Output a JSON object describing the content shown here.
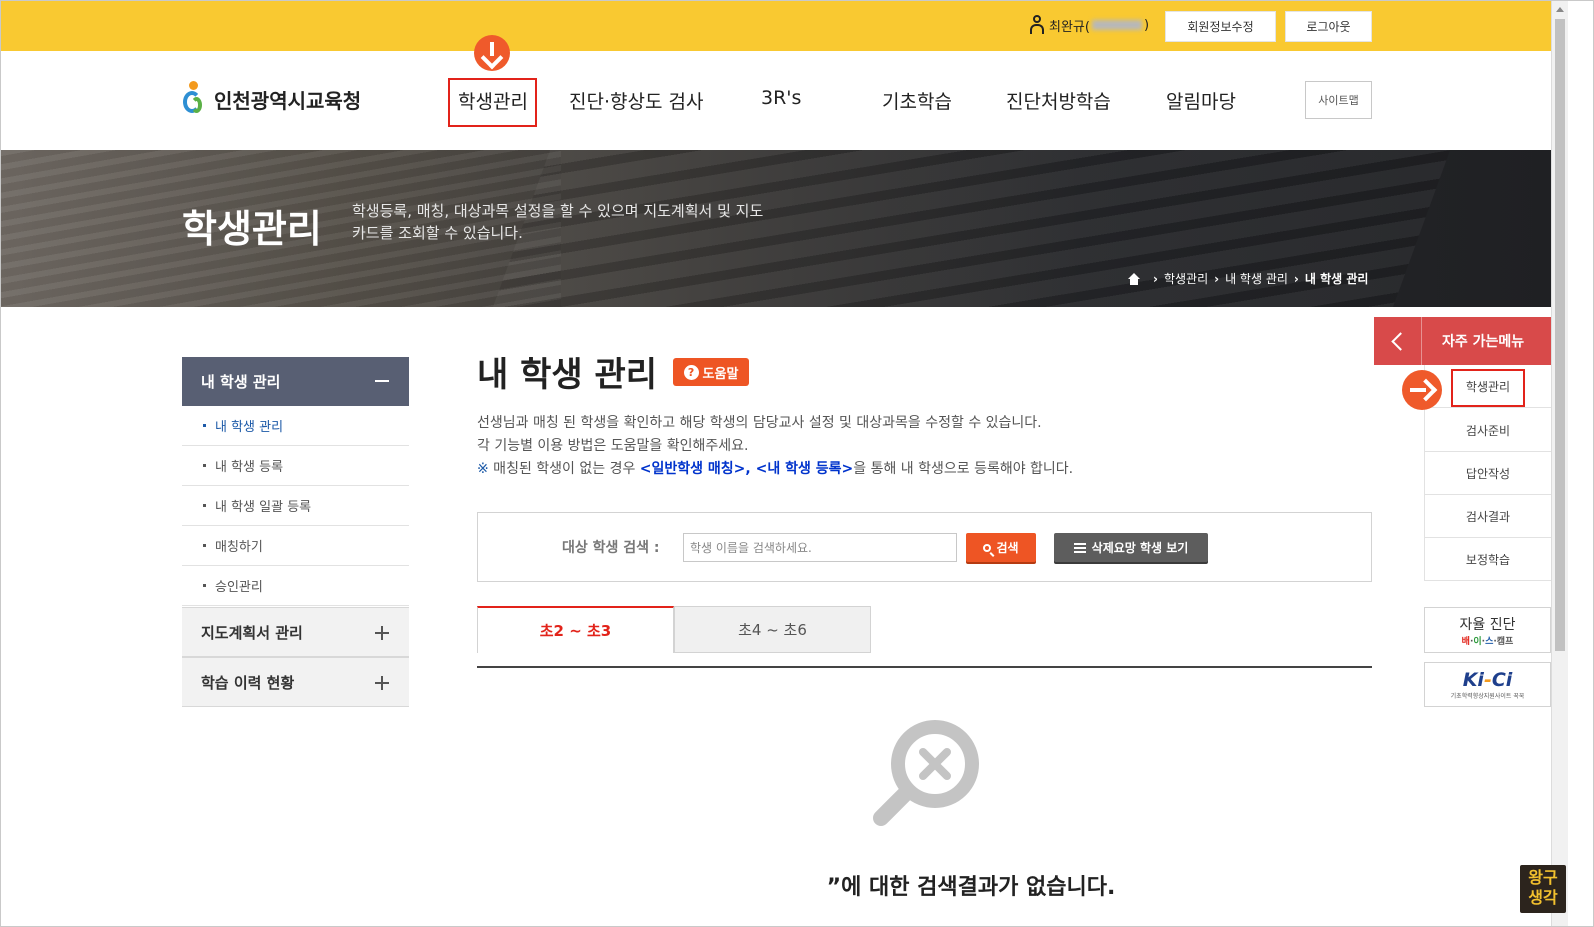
{
  "topbar": {
    "user_name": "최완규(",
    "user_suffix": ")",
    "edit_profile": "회원정보수정",
    "logout": "로그아웃"
  },
  "header": {
    "logo_text": "인천광역시교육청",
    "nav": [
      "학생관리",
      "진단·향상도 검사",
      "3R's",
      "기초학습",
      "진단처방학습",
      "알림마당"
    ],
    "sitemap": "사이트맵"
  },
  "banner": {
    "title": "학생관리",
    "desc": "학생등록, 매칭, 대상과목 설정을 할 수 있으며 지도계획서 및 지도카드를 조회할 수 있습니다.",
    "breadcrumb": [
      "학생관리",
      "내 학생 관리",
      "내 학생 관리"
    ]
  },
  "sidebar": {
    "head": "내 학생 관리",
    "subs": [
      "내 학생 관리",
      "내 학생 등록",
      "내 학생 일괄 등록",
      "매칭하기",
      "승인관리"
    ],
    "groups": [
      "지도계획서 관리",
      "학습 이력 현황"
    ]
  },
  "main": {
    "title": "내 학생 관리",
    "help": "도움말",
    "desc_line1": "선생님과 매칭 된 학생을 확인하고 해당 학생의 담당교사 설정 및 대상과목을 수정할 수 있습니다.",
    "desc_line2": "각 기능별 이용 방법은 도움말을 확인해주세요.",
    "note_mark": "※",
    "note_pre": " 매칭된 학생이 없는 경우 ",
    "note_link1": "<일반학생 매칭>",
    "note_comma": ", ",
    "note_link2": "<내 학생 등록>",
    "note_post": "을 통해 내 학생으로 등록해야 합니다.",
    "search_label": "대상 학생 검색 :",
    "search_placeholder": "학생 이름을 검색하세요.",
    "search_btn": "검색",
    "deleted_btn": "삭제요망 학생 보기",
    "tabs": [
      "초2 ~ 초3",
      "초4 ~ 초6"
    ],
    "empty_text": "”에 대한 검색결과가 없습니다."
  },
  "quick_menu": {
    "title": "자주 가는메뉴",
    "items": [
      "학생관리",
      "검사준비",
      "답안작성",
      "검사결과",
      "보정학습"
    ],
    "banner1_line1": "자율 진단",
    "banner1_p1": "배",
    "banner1_dot1": "·",
    "banner1_p2": "이",
    "banner1_dot2": "·",
    "banner1_p3": "스",
    "banner1_dot3": "·",
    "banner1_p4": "캠프",
    "banner2_logo_a": "Ki",
    "banner2_logo_b": "-",
    "banner2_logo_c": "Ci",
    "banner2_sub": "기초학력향상지원사이트 꾹꾹"
  },
  "watermark": {
    "line1": "왕구",
    "line2": "생각"
  },
  "colors": {
    "topbar": "#f9c931",
    "accent": "#ee5524",
    "highlight": "#e2231a",
    "sidebar_head": "#585f73",
    "quick_head": "#d84a4a"
  }
}
